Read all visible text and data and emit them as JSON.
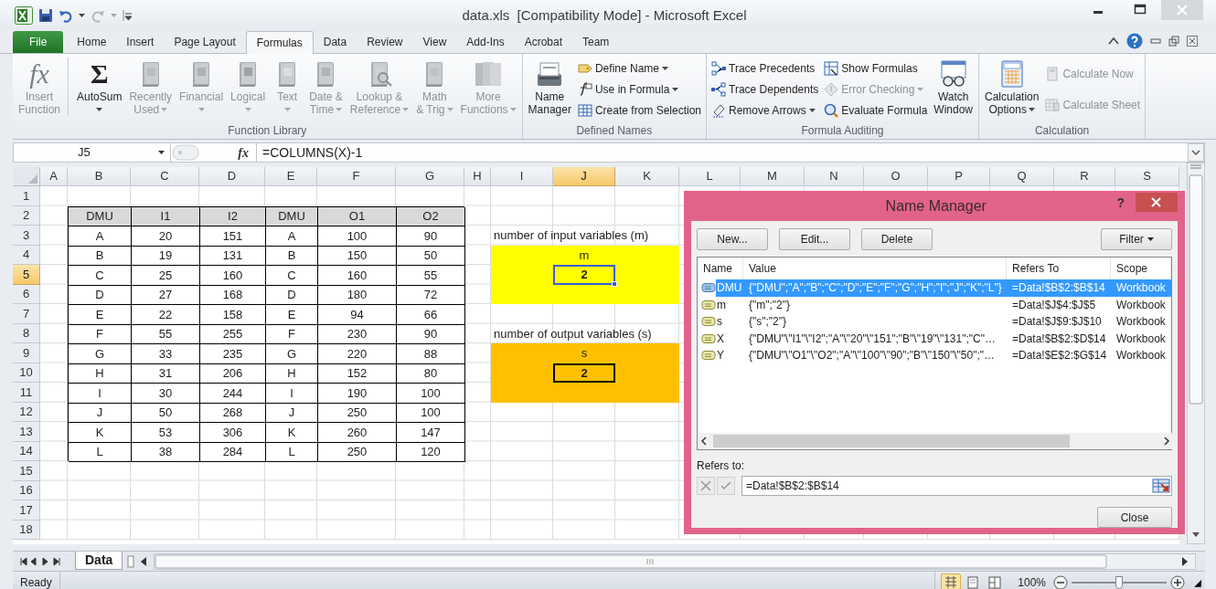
{
  "window": {
    "title": "data.xls  [Compatibility Mode] - Microsoft Excel"
  },
  "tabs": [
    {
      "label": "File",
      "kind": "file",
      "selected": false
    },
    {
      "label": "Home",
      "kind": "tab",
      "selected": false
    },
    {
      "label": "Insert",
      "kind": "tab",
      "selected": false
    },
    {
      "label": "Page Layout",
      "kind": "tab",
      "selected": false
    },
    {
      "label": "Formulas",
      "kind": "tab",
      "selected": true
    },
    {
      "label": "Data",
      "kind": "tab",
      "selected": false
    },
    {
      "label": "Review",
      "kind": "tab",
      "selected": false
    },
    {
      "label": "View",
      "kind": "tab",
      "selected": false
    },
    {
      "label": "Add-Ins",
      "kind": "tab",
      "selected": false
    },
    {
      "label": "Acrobat",
      "kind": "tab",
      "selected": false
    },
    {
      "label": "Team",
      "kind": "tab",
      "selected": false
    }
  ],
  "ribbon": {
    "groups": [
      {
        "title": "Function Library",
        "items": [
          {
            "kind": "large",
            "glyph": "fx",
            "lines": [
              "Insert",
              "Function"
            ],
            "disabled": true,
            "dropdown": false
          },
          {
            "kind": "large",
            "glyph": "Σ",
            "lines": [
              "AutoSum"
            ],
            "disabled": false,
            "dropdown": true
          },
          {
            "kind": "large",
            "lines": [
              "Recently",
              "Used"
            ],
            "disabled": true,
            "dropdown": true
          },
          {
            "kind": "large",
            "lines": [
              "Financial"
            ],
            "disabled": true,
            "dropdown": true
          },
          {
            "kind": "large",
            "lines": [
              "Logical"
            ],
            "disabled": true,
            "dropdown": true
          },
          {
            "kind": "large",
            "lines": [
              "Text"
            ],
            "disabled": true,
            "dropdown": true
          },
          {
            "kind": "large",
            "lines": [
              "Date &",
              "Time"
            ],
            "disabled": true,
            "dropdown": true
          },
          {
            "kind": "large",
            "lines": [
              "Lookup &",
              "Reference"
            ],
            "disabled": true,
            "dropdown": true
          },
          {
            "kind": "large",
            "lines": [
              "Math",
              "& Trig"
            ],
            "disabled": true,
            "dropdown": true
          },
          {
            "kind": "large",
            "lines": [
              "More",
              "Functions"
            ],
            "disabled": true,
            "dropdown": true
          }
        ]
      },
      {
        "title": "Defined Names",
        "items": [
          {
            "kind": "large",
            "lines": [
              "Name",
              "Manager"
            ],
            "disabled": false,
            "dropdown": false
          },
          {
            "kind": "small",
            "lines": [
              "Define Name"
            ],
            "disabled": false,
            "dropdown": true
          },
          {
            "kind": "small",
            "lines": [
              "Use in Formula"
            ],
            "disabled": false,
            "dropdown": true
          },
          {
            "kind": "small",
            "lines": [
              "Create from Selection"
            ],
            "disabled": false,
            "dropdown": false
          }
        ]
      },
      {
        "title": "Formula Auditing",
        "items": [
          {
            "kind": "small",
            "lines": [
              "Trace Precedents"
            ],
            "disabled": false,
            "dropdown": false
          },
          {
            "kind": "small",
            "lines": [
              "Trace Dependents"
            ],
            "disabled": false,
            "dropdown": false
          },
          {
            "kind": "small",
            "lines": [
              "Remove Arrows"
            ],
            "disabled": false,
            "dropdown": true
          },
          {
            "kind": "small",
            "lines": [
              "Show Formulas"
            ],
            "disabled": false,
            "dropdown": false
          },
          {
            "kind": "small",
            "lines": [
              "Error Checking"
            ],
            "disabled": true,
            "dropdown": true
          },
          {
            "kind": "small",
            "lines": [
              "Evaluate Formula"
            ],
            "disabled": false,
            "dropdown": false
          },
          {
            "kind": "large",
            "lines": [
              "Watch",
              "Window"
            ],
            "disabled": false,
            "dropdown": false
          }
        ]
      },
      {
        "title": "Calculation",
        "items": [
          {
            "kind": "large",
            "lines": [
              "Calculation",
              "Options"
            ],
            "disabled": false,
            "dropdown": true
          },
          {
            "kind": "small",
            "lines": [
              "Calculate Now"
            ],
            "disabled": true,
            "dropdown": false
          },
          {
            "kind": "small",
            "lines": [
              "Calculate Sheet"
            ],
            "disabled": true,
            "dropdown": false
          }
        ]
      }
    ]
  },
  "formula_bar": {
    "name_box": "J5",
    "fx": "fx",
    "formula": "=COLUMNS(X)-1"
  },
  "sheet": {
    "columns": [
      {
        "label": "A",
        "selected": false
      },
      {
        "label": "B",
        "selected": false
      },
      {
        "label": "C",
        "selected": false
      },
      {
        "label": "D",
        "selected": false
      },
      {
        "label": "E",
        "selected": false
      },
      {
        "label": "F",
        "selected": false
      },
      {
        "label": "G",
        "selected": false
      },
      {
        "label": "H",
        "selected": false
      },
      {
        "label": "I",
        "selected": false
      },
      {
        "label": "J",
        "selected": true
      },
      {
        "label": "K",
        "selected": false
      },
      {
        "label": "L",
        "selected": false
      },
      {
        "label": "M",
        "selected": false
      },
      {
        "label": "N",
        "selected": false
      },
      {
        "label": "O",
        "selected": false
      },
      {
        "label": "P",
        "selected": false
      },
      {
        "label": "Q",
        "selected": false
      },
      {
        "label": "R",
        "selected": false
      },
      {
        "label": "S",
        "selected": false
      }
    ],
    "rows": [
      {
        "label": "1",
        "selected": false
      },
      {
        "label": "2",
        "selected": false
      },
      {
        "label": "3",
        "selected": false
      },
      {
        "label": "4",
        "selected": false
      },
      {
        "label": "5",
        "selected": true
      },
      {
        "label": "6",
        "selected": false
      },
      {
        "label": "7",
        "selected": false
      },
      {
        "label": "8",
        "selected": false
      },
      {
        "label": "9",
        "selected": false
      },
      {
        "label": "10",
        "selected": false
      },
      {
        "label": "11",
        "selected": false
      },
      {
        "label": "12",
        "selected": false
      },
      {
        "label": "13",
        "selected": false
      },
      {
        "label": "14",
        "selected": false
      },
      {
        "label": "15",
        "selected": false
      },
      {
        "label": "16",
        "selected": false
      },
      {
        "label": "17",
        "selected": false
      },
      {
        "label": "18",
        "selected": false
      }
    ],
    "table": {
      "header": [
        "DMU",
        "I1",
        "I2",
        "DMU",
        "O1",
        "O2"
      ],
      "rows": [
        [
          "A",
          "20",
          "151",
          "A",
          "100",
          "90"
        ],
        [
          "B",
          "19",
          "131",
          "B",
          "150",
          "50"
        ],
        [
          "C",
          "25",
          "160",
          "C",
          "160",
          "55"
        ],
        [
          "D",
          "27",
          "168",
          "D",
          "180",
          "72"
        ],
        [
          "E",
          "22",
          "158",
          "E",
          "94",
          "66"
        ],
        [
          "F",
          "55",
          "255",
          "F",
          "230",
          "90"
        ],
        [
          "G",
          "33",
          "235",
          "G",
          "220",
          "88"
        ],
        [
          "H",
          "31",
          "206",
          "H",
          "152",
          "80"
        ],
        [
          "I",
          "30",
          "244",
          "I",
          "190",
          "100"
        ],
        [
          "J",
          "50",
          "268",
          "J",
          "250",
          "100"
        ],
        [
          "K",
          "53",
          "306",
          "K",
          "260",
          "147"
        ],
        [
          "L",
          "38",
          "284",
          "L",
          "250",
          "120"
        ]
      ]
    },
    "panels": [
      {
        "caption": "number of input variables (m)",
        "label": "m",
        "value": "2",
        "color": "#ffff00",
        "selected": true
      },
      {
        "caption": "number of output variables (s)",
        "label": "s",
        "value": "2",
        "color": "#ffc000",
        "selected": false
      }
    ]
  },
  "sheet_tabs": [
    {
      "label": "Data",
      "selected": true
    }
  ],
  "status_bar": {
    "text": "Ready",
    "view_buttons": [
      {
        "selected": true
      },
      {
        "selected": false
      },
      {
        "selected": false
      }
    ],
    "zoom": {
      "reading": "100%",
      "level": 0.5
    }
  },
  "name_manager": {
    "title": "Name Manager",
    "help": "?",
    "buttons": [
      "New...",
      "Edit...",
      "Delete"
    ],
    "filter": "Filter",
    "columns": [
      "Name",
      "Value",
      "Refers To",
      "Scope"
    ],
    "rows": [
      {
        "name": "DMU",
        "value": "{\"DMU\";\"A\";\"B\";\"C\";\"D\";\"E\";\"F\";\"G\";\"H\";\"I\";\"J\";\"K\";\"L\"}",
        "refers_to": "=Data!$B$2:$B$14",
        "scope": "Workbook",
        "selected": true
      },
      {
        "name": "m",
        "value": "{\"m\";\"2\"}",
        "refers_to": "=Data!$J$4:$J$5",
        "scope": "Workbook",
        "selected": false
      },
      {
        "name": "s",
        "value": "{\"s\";\"2\"}",
        "refers_to": "=Data!$J$9:$J$10",
        "scope": "Workbook",
        "selected": false
      },
      {
        "name": "X",
        "value": "{\"DMU\"\\\"I1\"\\\"I2\";\"A\"\\\"20\"\\\"151\";\"B\"\\\"19\"\\\"131\";\"C\"…",
        "refers_to": "=Data!$B$2:$D$14",
        "scope": "Workbook",
        "selected": false
      },
      {
        "name": "Y",
        "value": "{\"DMU\"\\\"O1\"\\\"O2\";\"A\"\\\"100\"\\\"90\";\"B\"\\\"150\"\\\"50\";\"…",
        "refers_to": "=Data!$E$2:$G$14",
        "scope": "Workbook",
        "selected": false
      }
    ],
    "refers_label": "Refers to:",
    "refers_value": "=Data!$B$2:$B$14",
    "close": "Close"
  }
}
